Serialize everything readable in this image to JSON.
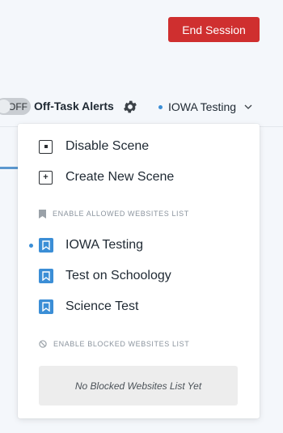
{
  "header": {
    "end_session_label": "End Session"
  },
  "toolbar": {
    "toggle_state": "OFF",
    "off_task_alerts_label": "Off-Task Alerts",
    "current_scene": "IOWA Testing"
  },
  "dropdown": {
    "actions": [
      {
        "label": "Disable Scene",
        "icon": "square-dot-icon"
      },
      {
        "label": "Create New Scene",
        "icon": "square-plus-icon"
      }
    ],
    "allowed_section_title": "ENABLE ALLOWED WEBSITES LIST",
    "allowed_lists": [
      {
        "label": "IOWA Testing",
        "active": true
      },
      {
        "label": "Test on Schoology",
        "active": false
      },
      {
        "label": "Science Test",
        "active": false
      }
    ],
    "blocked_section_title": "ENABLE BLOCKED WEBSITES LIST",
    "blocked_empty_text": "No Blocked Websites List Yet"
  },
  "colors": {
    "accent": "#3b8ed6",
    "danger": "#cf2f2f"
  }
}
